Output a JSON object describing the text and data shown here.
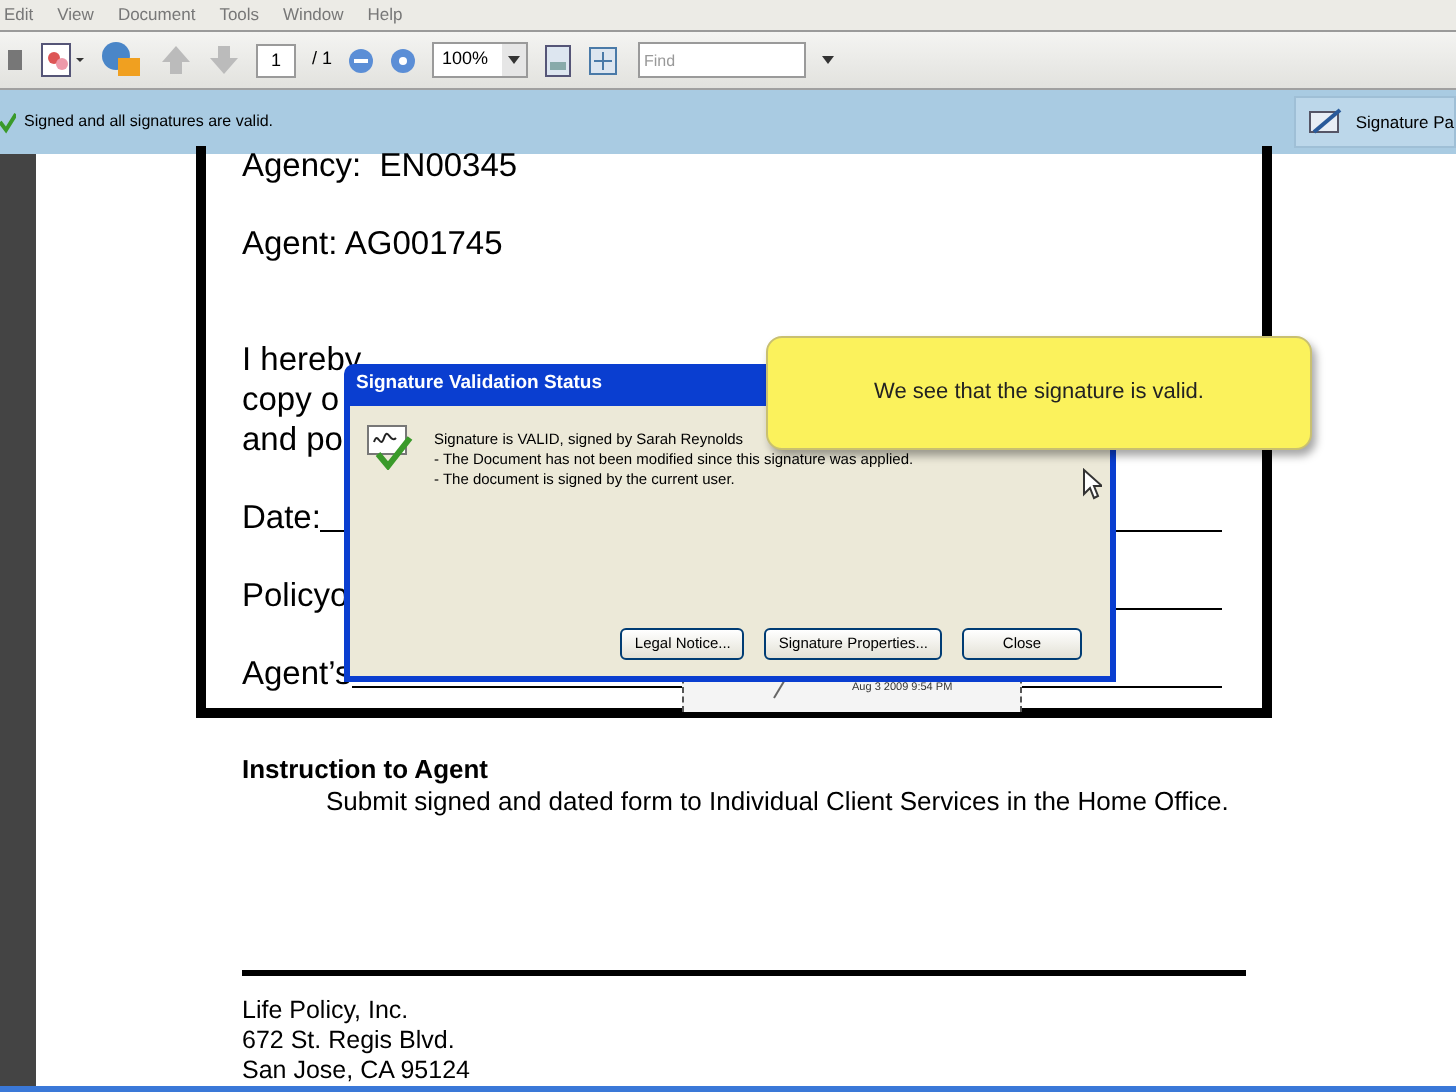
{
  "menu_bar": {
    "items": [
      "Edit",
      "View",
      "Document",
      "Tools",
      "Window",
      "Help"
    ]
  },
  "toolbar": {
    "page_number": "1",
    "page_total": "/ 1",
    "zoom": "100%",
    "find": {
      "placeholder": "Find"
    }
  },
  "message_bar": {
    "text": "Signed and all signatures are valid.",
    "button": "Signature Pa"
  },
  "document": {
    "blocks": [
      {
        "kind": "field",
        "lines": [
          "Agency:  EN00345"
        ],
        "underline": false
      },
      {
        "kind": "field",
        "lines": [
          "Agent: AG001745"
        ],
        "underline": false
      },
      {
        "kind": "paragraph",
        "lines": [
          "I hereby",
          "copy o",
          "and po"
        ],
        "underline": false
      },
      {
        "kind": "field",
        "lines": [
          "Date:"
        ],
        "underline": true
      },
      {
        "kind": "field",
        "lines": [
          "Policyo"
        ],
        "underline": true
      },
      {
        "kind": "field",
        "lines": [
          "Agent’s"
        ],
        "underline": true
      }
    ],
    "signature_field": {
      "timestamp": "Aug 3 2009 9:54 PM"
    },
    "instruction": {
      "heading": "Instruction to Agent",
      "text": "Submit signed and dated form to Individual Client Services in the Home Office."
    },
    "footer_lines": [
      "Life Policy, Inc.",
      "672 St. Regis Blvd.",
      "San Jose, CA 95124"
    ]
  },
  "dialog": {
    "title": "Signature Validation Status",
    "message_lines": [
      "Signature is VALID, signed by Sarah Reynolds",
      "- The Document has not been modified since this signature was applied.",
      "- The document is signed by the current user."
    ],
    "buttons": [
      "Legal Notice...",
      "Signature Properties...",
      "Close"
    ]
  },
  "callout": {
    "text": "We see that the signature is valid."
  }
}
